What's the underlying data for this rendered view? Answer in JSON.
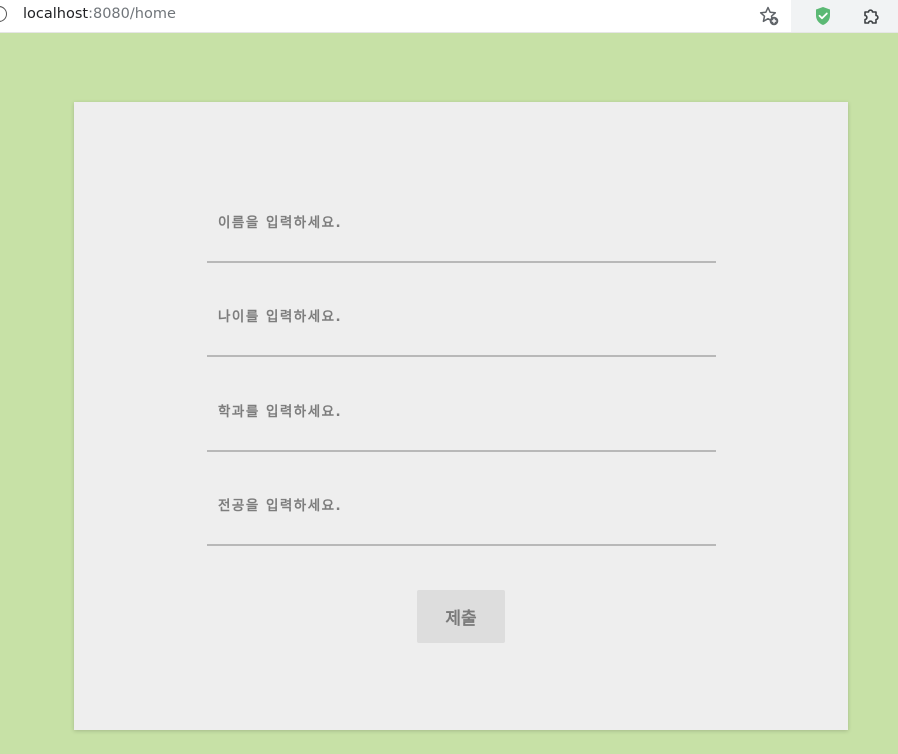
{
  "browser": {
    "url_host": "localhost",
    "url_rest": ":8080/home",
    "icons": [
      "info-icon",
      "star-add-icon",
      "shield-check-icon",
      "puzzle-icon"
    ],
    "shield_color": "#5bb974"
  },
  "form": {
    "fields": [
      {
        "placeholder": "이름을 입력하세요."
      },
      {
        "placeholder": "나이를 입력하세요."
      },
      {
        "placeholder": "학과를 입력하세요."
      },
      {
        "placeholder": "전공을 입력하세요."
      }
    ],
    "submit_label": "제출"
  },
  "colors": {
    "page_background": "#c7e1a6",
    "panel_background": "#eeeeee",
    "button_background": "#dddddd"
  }
}
